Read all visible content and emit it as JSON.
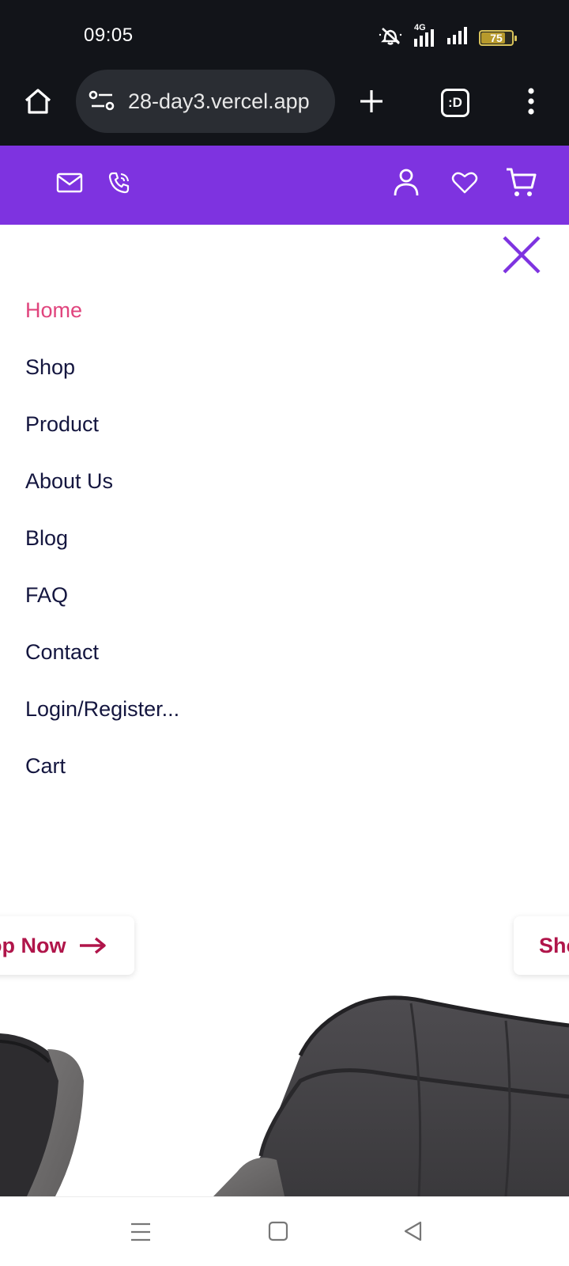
{
  "status_bar": {
    "time": "09:05",
    "network": "4G",
    "battery_level": "75",
    "icons": [
      "mute-icon",
      "signal-4g-icon",
      "signal-icon",
      "battery-icon"
    ]
  },
  "browser": {
    "url": "28-day3.vercel.app",
    "tab_count": ":D",
    "icons": [
      "home-icon",
      "site-settings-icon",
      "new-tab-icon",
      "tab-switcher-icon",
      "more-icon"
    ]
  },
  "site_topbar": {
    "background": "#7e33e0",
    "left_icons": [
      "mail-icon",
      "phone-icon"
    ],
    "right_icons": [
      "user-icon",
      "heart-icon",
      "cart-icon"
    ]
  },
  "menu": {
    "accent": "#e0447d",
    "text_color": "#14163f",
    "close_icon": "close-icon",
    "items": [
      {
        "label": "Home",
        "active": true
      },
      {
        "label": "Shop",
        "active": false
      },
      {
        "label": "Product",
        "active": false
      },
      {
        "label": "About Us",
        "active": false
      },
      {
        "label": "Blog",
        "active": false
      },
      {
        "label": "FAQ",
        "active": false
      },
      {
        "label": "Contact",
        "active": false
      },
      {
        "label": "Login/Register...",
        "active": false
      },
      {
        "label": "Cart",
        "active": false
      }
    ]
  },
  "hero": {
    "left_button_label": "op Now",
    "right_button_label": "Sho",
    "button_color": "#b0154a"
  },
  "android_nav": {
    "icons": [
      "recents-icon",
      "home-square-icon",
      "back-icon"
    ]
  }
}
